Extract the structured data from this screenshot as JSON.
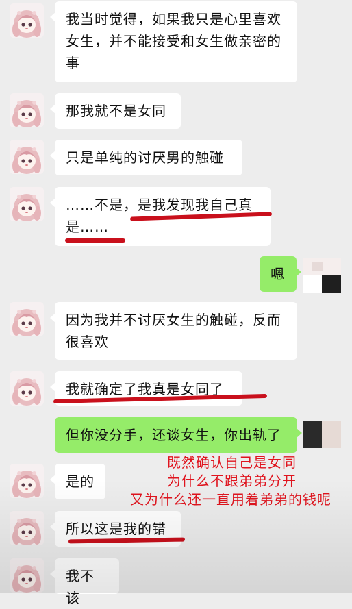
{
  "messages": [
    {
      "side": "left",
      "text": "我当时觉得，如果我只是心里喜欢女生，并不能接受和女生做亲密的事"
    },
    {
      "side": "left",
      "text": "那我就不是女同"
    },
    {
      "side": "left",
      "text": "只是单纯的讨厌男的触碰"
    },
    {
      "side": "left",
      "text": "……不是，是我发现我自己真是……"
    },
    {
      "side": "right",
      "text": "嗯"
    },
    {
      "side": "left",
      "text": "因为我并不讨厌女生的触碰，反而很喜欢"
    },
    {
      "side": "left",
      "text": "我就确定了我真是女同了"
    },
    {
      "side": "right",
      "text": "但你没分手，还谈女生，你出轨了"
    },
    {
      "side": "left",
      "text": "是的"
    },
    {
      "side": "left",
      "text": "所以这是我的错"
    },
    {
      "side": "left",
      "text": "我不该"
    }
  ],
  "annotation": {
    "line1": "既然确认自己是女同",
    "line2": "为什么不跟弟弟分开",
    "line3": "又为什么还一直用着弟弟的钱呢",
    "color": "#e0141e"
  },
  "colors": {
    "background": "#ededed",
    "incoming_bubble": "#ffffff",
    "outgoing_bubble": "#95ec69",
    "underline": "#c9101c"
  },
  "icons": {
    "contact_avatar": "anime-girl-avatar-icon",
    "my_avatar": "blurred-avatar-icon"
  }
}
